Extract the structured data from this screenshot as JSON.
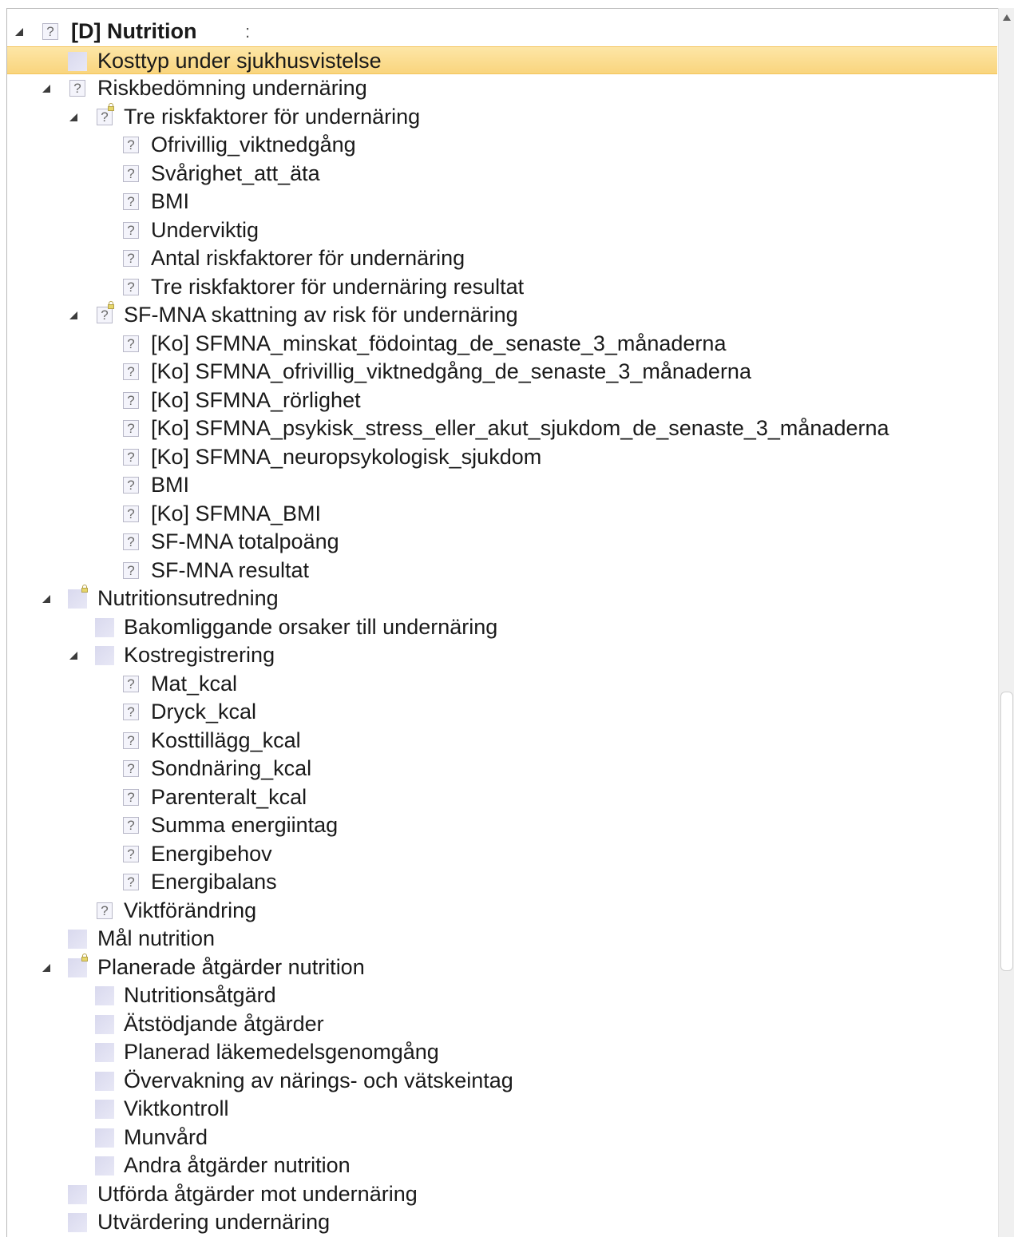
{
  "tree": {
    "root": {
      "label": "[D] Nutrition",
      "extra": ":"
    },
    "items": [
      "Kosttyp under sjukhusvistelse",
      "Riskbedömning undernäring",
      "Tre riskfaktorer för undernäring",
      "Ofrivillig_viktnedgång",
      "Svårighet_att_äta",
      "BMI",
      "Underviktig",
      "Antal riskfaktorer för undernäring",
      "Tre riskfaktorer för undernäring resultat",
      "SF-MNA skattning av risk för undernäring",
      "[Ko] SFMNA_minskat_födointag_de_senaste_3_månaderna",
      "[Ko] SFMNA_ofrivillig_viktnedgång_de_senaste_3_månaderna",
      "[Ko] SFMNA_rörlighet",
      "[Ko] SFMNA_psykisk_stress_eller_akut_sjukdom_de_senaste_3_månaderna",
      "[Ko] SFMNA_neuropsykologisk_sjukdom",
      "BMI",
      "[Ko] SFMNA_BMI",
      "SF-MNA totalpoäng",
      "SF-MNA resultat",
      "Nutritionsutredning",
      "Bakomliggande orsaker till undernäring",
      "Kostregistrering",
      "Mat_kcal",
      "Dryck_kcal",
      "Kosttillägg_kcal",
      "Sondnäring_kcal",
      "Parenteralt_kcal",
      "Summa energiintag",
      "Energibehov",
      "Energibalans",
      "Viktförändring",
      "Mål nutrition",
      "Planerade åtgärder nutrition",
      "Nutritionsåtgärd",
      "Ätstödjande åtgärder",
      "Planerad läkemedelsgenomgång",
      "Övervakning av närings- och vätskeintag",
      "Viktkontroll",
      "Munvård",
      "Andra åtgärder nutrition",
      "Utförda åtgärder mot undernäring",
      "Utvärdering undernäring"
    ]
  },
  "colors": {
    "selected_bg": "#fbdc8f",
    "text": "#1a1a1a"
  }
}
